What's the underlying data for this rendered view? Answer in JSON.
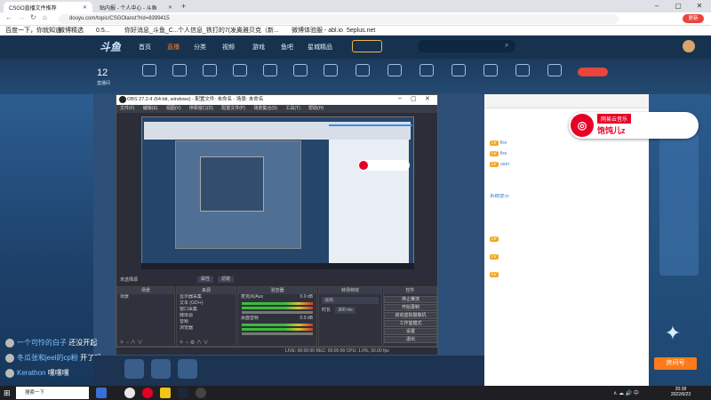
{
  "browser": {
    "tabs": [
      {
        "title": "CSGO直播文件推荐",
        "active": true
      },
      {
        "title": "贴内报 - 个人中心 - 斗鱼",
        "active": false
      }
    ],
    "new_tab": "+",
    "address": "douyu.com/topic/CSGOlanst?rid=8399415",
    "update_btn": "更新",
    "bookmarks": [
      "百度一下，你就知道",
      "微博精选",
      "0.5...",
      "你好消息_斗鱼_C...",
      "个人信息_铁打的7(发...",
      "奥雅贝克（新...",
      "微博体验服 - abl.io",
      "5eplus.net"
    ]
  },
  "site": {
    "nav": [
      "首页",
      "直播",
      "分类",
      "视频",
      "游戏",
      "鱼吧",
      "星城精品"
    ],
    "active_nav": "直播",
    "live_count": "12",
    "live_count_label": "直播间"
  },
  "obs": {
    "title": "OBS 27.2.4 (64-bit, windows) - 配置文件: 未命名 - 场景: 未命名",
    "menu": [
      "文件(F)",
      "编辑(E)",
      "视图(V)",
      "停靠窗口(D)",
      "配置文件(P)",
      "场景集合(S)",
      "工具(T)",
      "帮助(H)"
    ],
    "no_source": "未选择源",
    "props_btn": "属性",
    "filter_btn": "滤镜",
    "docks": {
      "scenes": "场景",
      "sources": "来源",
      "mixer": "混音器",
      "transitions": "转场特效",
      "controls": "控件"
    },
    "scene_items": [
      "场景"
    ],
    "source_items": [
      "显示器采集",
      "文本 (GDI+)",
      "窗口采集",
      "媒体源",
      "音频",
      "浏览器"
    ],
    "mixer_items": [
      "麦克风/Aux",
      "桌面音频"
    ],
    "mixer_levels": [
      "0.0 dB",
      "0.0 dB"
    ],
    "transition": "淡出",
    "duration_label": "时长",
    "duration": "300 ms",
    "controls": [
      "停止推流",
      "开始录制",
      "启动虚拟摄像机",
      "工作室模式",
      "设置",
      "退出"
    ],
    "status": "LIVE: 00:00:00   REC: 00:00:00   CPU: 1.0%, 30.00 fps"
  },
  "preview": {
    "netease_brand": "网易云音乐",
    "netease_user": "饱饨儿z"
  },
  "danmaku": [
    {
      "user": "一个可怜的白子",
      "msg": "还没开起"
    },
    {
      "user": "冬瓜张和jeel的cp粉",
      "msg": "开了吗"
    },
    {
      "user": "Kerathon",
      "msg": "嘿嘿嘿"
    }
  ],
  "room_btn": "房间号",
  "taskbar": {
    "search": "搜索一下",
    "time": "20:38",
    "date": "2022/6/23"
  },
  "colors": {
    "accent": "#ff7a1a",
    "obs_bg": "#2b2e38",
    "netease_red": "#e60026"
  }
}
